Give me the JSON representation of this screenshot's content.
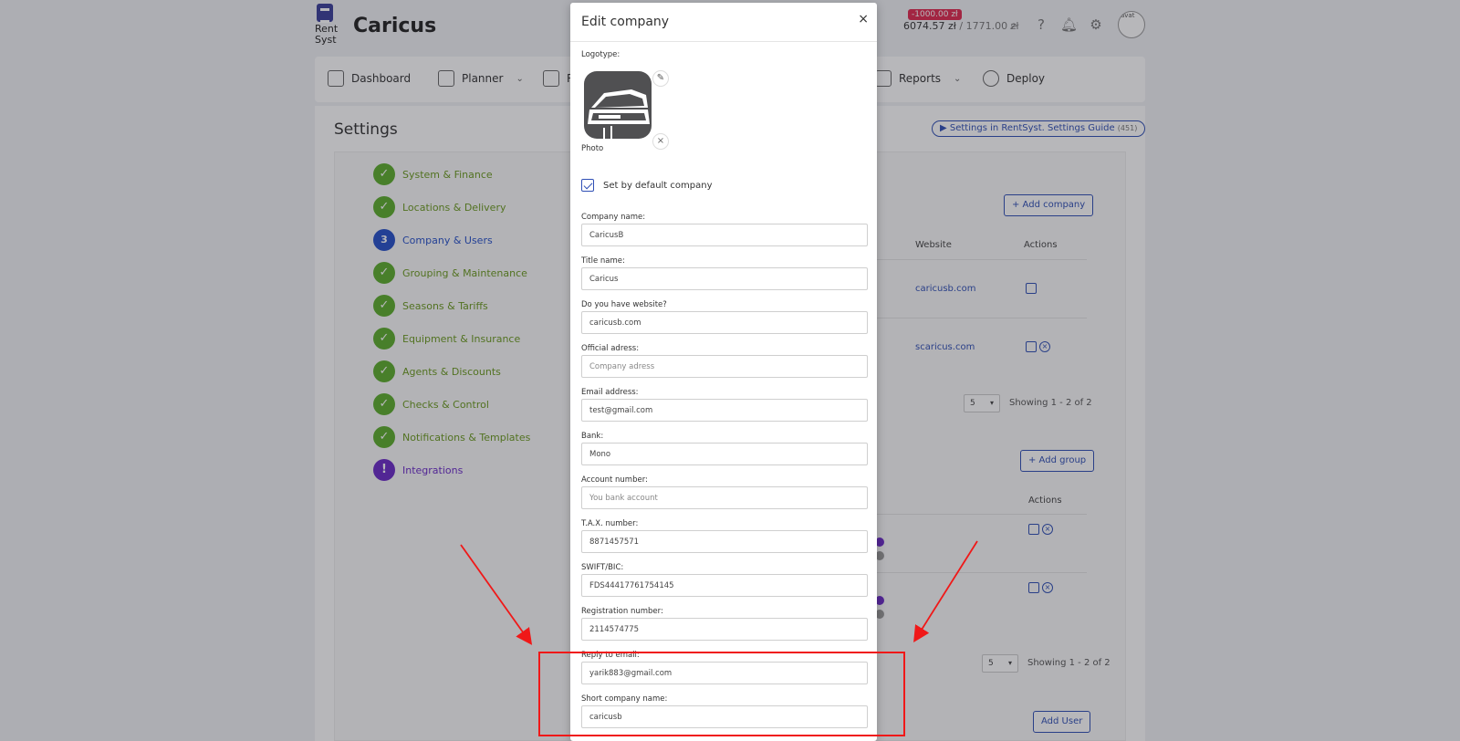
{
  "topbar": {
    "logo_line1": "Rent",
    "logo_line2": "Syst",
    "brand": "Caricus",
    "balance_negative": "-1000.00 zł",
    "balance_main": "6074.57 zł",
    "balance_sep": " / ",
    "balance_total": "1771.00 zł",
    "avatar_alt": "avat"
  },
  "nav": {
    "items": [
      {
        "label": "Dashboard"
      },
      {
        "label": "Planner"
      },
      {
        "label": "R"
      },
      {
        "label": "Reports"
      },
      {
        "label": "Deploy"
      }
    ]
  },
  "settings": {
    "title": "Settings",
    "guide_label": "Settings in RentSyst. Settings Guide",
    "guide_count": "(451)",
    "steps": [
      {
        "label": "System & Finance",
        "marker": "✓"
      },
      {
        "label": "Locations & Delivery",
        "marker": "✓"
      },
      {
        "label": "Company & Users",
        "marker": "3"
      },
      {
        "label": "Grouping & Maintenance",
        "marker": "✓"
      },
      {
        "label": "Seasons & Tariffs",
        "marker": "✓"
      },
      {
        "label": "Equipment & Insurance",
        "marker": "✓"
      },
      {
        "label": "Agents & Discounts",
        "marker": "✓"
      },
      {
        "label": "Checks & Control",
        "marker": "✓"
      },
      {
        "label": "Notifications & Templates",
        "marker": "✓"
      },
      {
        "label": "Integrations",
        "marker": "!"
      }
    ],
    "add_company": "+ Add company",
    "col_website": "Website",
    "col_actions": "Actions",
    "col_actions2": "Actions",
    "row1_site": "caricusb.com",
    "row2_site": "scaricus.com",
    "pager1_value": "5",
    "pager1_text": "Showing 1 - 2 of 2",
    "add_group": "+ Add group",
    "pager2_value": "5",
    "pager2_text": "Showing 1 - 2 of 2",
    "add_user": "Add User"
  },
  "modal": {
    "title": "Edit company",
    "close": "×",
    "logotype_label": "Logotype:",
    "photo_label": "Photo",
    "edit_glyph": "✎",
    "remove_glyph": "×",
    "default_label": "Set by default company",
    "fields": [
      {
        "label": "Company name:",
        "value": "CaricusB",
        "placeholder": ""
      },
      {
        "label": "Title name:",
        "value": "Caricus",
        "placeholder": ""
      },
      {
        "label": "Do you have website?",
        "value": "caricusb.com",
        "placeholder": ""
      },
      {
        "label": "Official adress:",
        "value": "",
        "placeholder": "Company adress"
      },
      {
        "label": "Email address:",
        "value": "test@gmail.com",
        "placeholder": ""
      },
      {
        "label": "Bank:",
        "value": "Mono",
        "placeholder": ""
      },
      {
        "label": "Account number:",
        "value": "",
        "placeholder": "You bank account"
      },
      {
        "label": "T.A.X. number:",
        "value": "8871457571",
        "placeholder": ""
      },
      {
        "label": "SWIFT/BIC:",
        "value": "FDS44417761754145",
        "placeholder": ""
      },
      {
        "label": "Registration number:",
        "value": "2114574775",
        "placeholder": ""
      },
      {
        "label": "Reply to email:",
        "value": "yarik883@gmail.com",
        "placeholder": ""
      },
      {
        "label": "Short company name:",
        "value": "caricusb",
        "placeholder": ""
      }
    ]
  },
  "colors": {
    "accent": "#2f4fb5",
    "success": "#5cad2c",
    "warning": "#6a2ac8",
    "annotation": "#f01818"
  },
  "icons": [
    "dashboard-icon",
    "planner-icon",
    "reports-icon",
    "gear-icon",
    "search-icon",
    "help-icon",
    "bell-icon",
    "settings-icon",
    "edit-icon",
    "close-icon",
    "check-icon"
  ]
}
